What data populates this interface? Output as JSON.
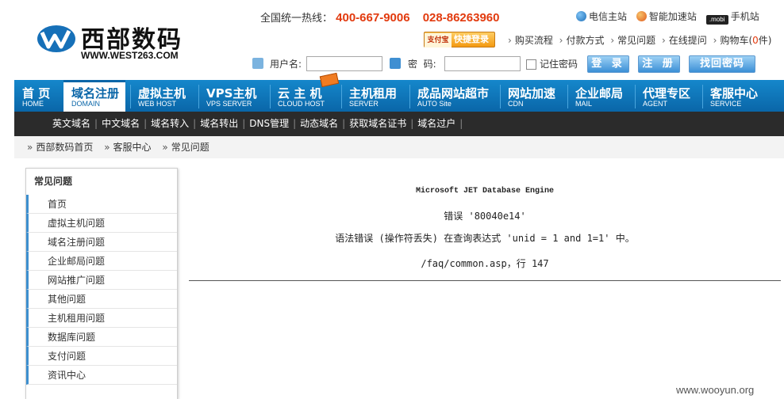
{
  "logo": {
    "name": "西部数码",
    "domain": "WWW.WEST263.COM"
  },
  "hotline": {
    "label": "全国统一热线：",
    "number1": "400-667-9006",
    "number2": "028-86263960"
  },
  "toplinks": {
    "telecom": "电信主站",
    "accelerate": "智能加速站",
    "mobi_badge": ".mobi",
    "mobile": "手机站"
  },
  "quicklogin": {
    "pay_text": "支付宝",
    "label": "快捷登录"
  },
  "sublinks": [
    "购买流程",
    "付款方式",
    "常见问题",
    "在线提问"
  ],
  "cart": {
    "label_before": "购物车(",
    "count": "0",
    "label_after": "件)"
  },
  "login": {
    "username_label": "用户名:",
    "password_label": "密  码:",
    "remember_label": "记住密码",
    "login_button": "登 录",
    "register_button": "注 册",
    "recover_button": "找回密码"
  },
  "nav": [
    {
      "cn": "首 页",
      "en": "HOME"
    },
    {
      "cn": "域名注册",
      "en": "DOMAIN"
    },
    {
      "cn": "虚拟主机",
      "en": "WEB HOST"
    },
    {
      "cn": "VPS主机",
      "en": "VPS SERVER"
    },
    {
      "cn": "云 主 机",
      "en": "CLOUD HOST"
    },
    {
      "cn": "主机租用",
      "en": "SERVER"
    },
    {
      "cn": "成品网站超市",
      "en": "AUTO Site"
    },
    {
      "cn": "网站加速",
      "en": "CDN"
    },
    {
      "cn": "企业邮局",
      "en": "MAIL"
    },
    {
      "cn": "代理专区",
      "en": "AGENT"
    },
    {
      "cn": "客服中心",
      "en": "SERVICE"
    }
  ],
  "subnav": [
    "英文域名",
    "中文域名",
    "域名转入",
    "域名转出",
    "DNS管理",
    "动态域名",
    "获取域名证书",
    "域名过户"
  ],
  "breadcrumb": [
    "西部数码首页",
    "客服中心",
    "常见问题"
  ],
  "sidebar": {
    "title": "常见问题",
    "items": [
      "首页",
      "虚拟主机问题",
      "域名注册问题",
      "企业邮局问题",
      "网站推广问题",
      "其他问题",
      "主机租用问题",
      "数据库问题",
      "支付问题",
      "资讯中心"
    ]
  },
  "error": {
    "engine": "Microsoft JET Database Engine",
    "code": "错误 '80040e14'",
    "message": "语法错误 (操作符丢失) 在查询表达式 'unid = 1  and  1=1' 中。",
    "location": "/faq/common.asp，行 147"
  },
  "watermark": "www.wooyun.org",
  "colors": {
    "nav_blue": "#0a66a8",
    "hotline_red": "#e23a0e",
    "subnav_dark": "#2b2b2b"
  }
}
